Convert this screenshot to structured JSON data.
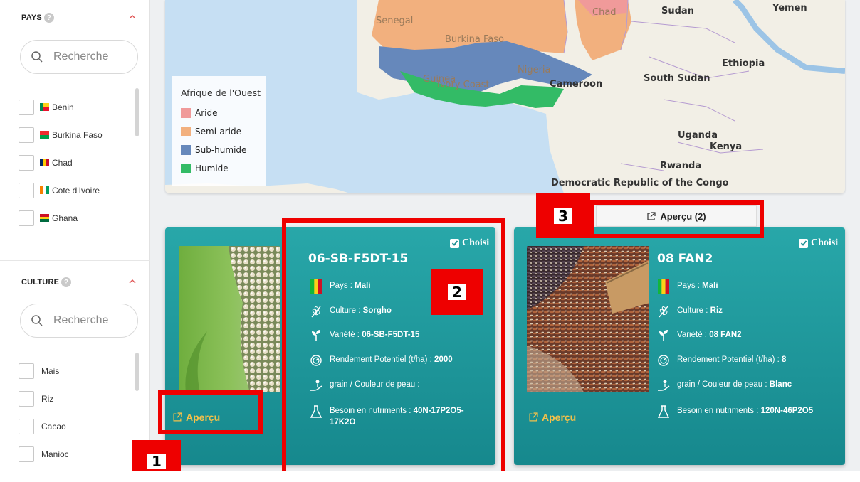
{
  "sidebar": {
    "pays": {
      "heading": "PAYS",
      "search_placeholder": "Recherche",
      "items": [
        {
          "label": "Benin",
          "flag": [
            "#008751",
            "#fcd116",
            "#e8112d"
          ]
        },
        {
          "label": "Burkina Faso",
          "flag": [
            "#ef2b2d",
            "#009e49"
          ]
        },
        {
          "label": "Chad",
          "flag": [
            "#002664",
            "#fecb00",
            "#c60c30"
          ]
        },
        {
          "label": "Cote d'Ivoire",
          "flag": [
            "#f77f00",
            "#ffffff",
            "#009e60"
          ]
        },
        {
          "label": "Ghana",
          "flag": [
            "#ce1126",
            "#fcd116",
            "#006b3f"
          ]
        }
      ]
    },
    "culture": {
      "heading": "CULTURE",
      "search_placeholder": "Recherche",
      "items": [
        {
          "label": "Mais"
        },
        {
          "label": "Riz"
        },
        {
          "label": "Cacao"
        },
        {
          "label": "Manioc"
        }
      ]
    }
  },
  "map": {
    "legend_title": "Afrique de l'Ouest",
    "legend": [
      {
        "label": "Aride",
        "color": "#f09a9a"
      },
      {
        "label": "Semi-aride",
        "color": "#f2b07e"
      },
      {
        "label": "Sub-humide",
        "color": "#6688bb"
      },
      {
        "label": "Humide",
        "color": "#33bb66"
      }
    ],
    "labels": {
      "senegal": "Senegal",
      "burkina": "Burkina Faso",
      "chad": "Chad",
      "sudan": "Sudan",
      "yemen": "Yemen",
      "guinea": "Guinea",
      "nigeria": "Nigeria",
      "ivory": "Ivory Coast",
      "cameroon": "Cameroon",
      "south_sudan": "South Sudan",
      "ethiopia": "Ethiopia",
      "uganda": "Uganda",
      "kenya": "Kenya",
      "rwanda": "Rwanda",
      "drc": "Democratic Republic of the Congo"
    }
  },
  "top_preview_label": "Aperçu (2)",
  "cards": [
    {
      "title": "06-SB-F5DT-15",
      "choisi": "Choisi",
      "pays_label": "Pays :",
      "pays": "Mali",
      "culture_label": "Culture :",
      "culture": "Sorgho",
      "variete_label": "Variété :",
      "variete": "06-SB-F5DT-15",
      "rendement_label": "Rendement Potentiel (t/ha) :",
      "rendement": "2000",
      "couleur_label": "grain / Couleur de peau :",
      "couleur": "",
      "besoin_label": "Besoin en nutriments :",
      "besoin": "40N-17P2O5-17K2O",
      "preview": "Aperçu"
    },
    {
      "title": "08 FAN2",
      "choisi": "Choisi",
      "pays_label": "Pays :",
      "pays": "Mali",
      "culture_label": "Culture :",
      "culture": "Riz",
      "variete_label": "Variété :",
      "variete": "08 FAN2",
      "rendement_label": "Rendement Potentiel (t/ha) :",
      "rendement": "8",
      "couleur_label": "grain / Couleur de peau :",
      "couleur": "Blanc",
      "besoin_label": "Besoin en nutriments :",
      "besoin": "120N-46P2O5",
      "preview": "Aperçu"
    }
  ],
  "annotations": [
    "1",
    "2",
    "3"
  ]
}
